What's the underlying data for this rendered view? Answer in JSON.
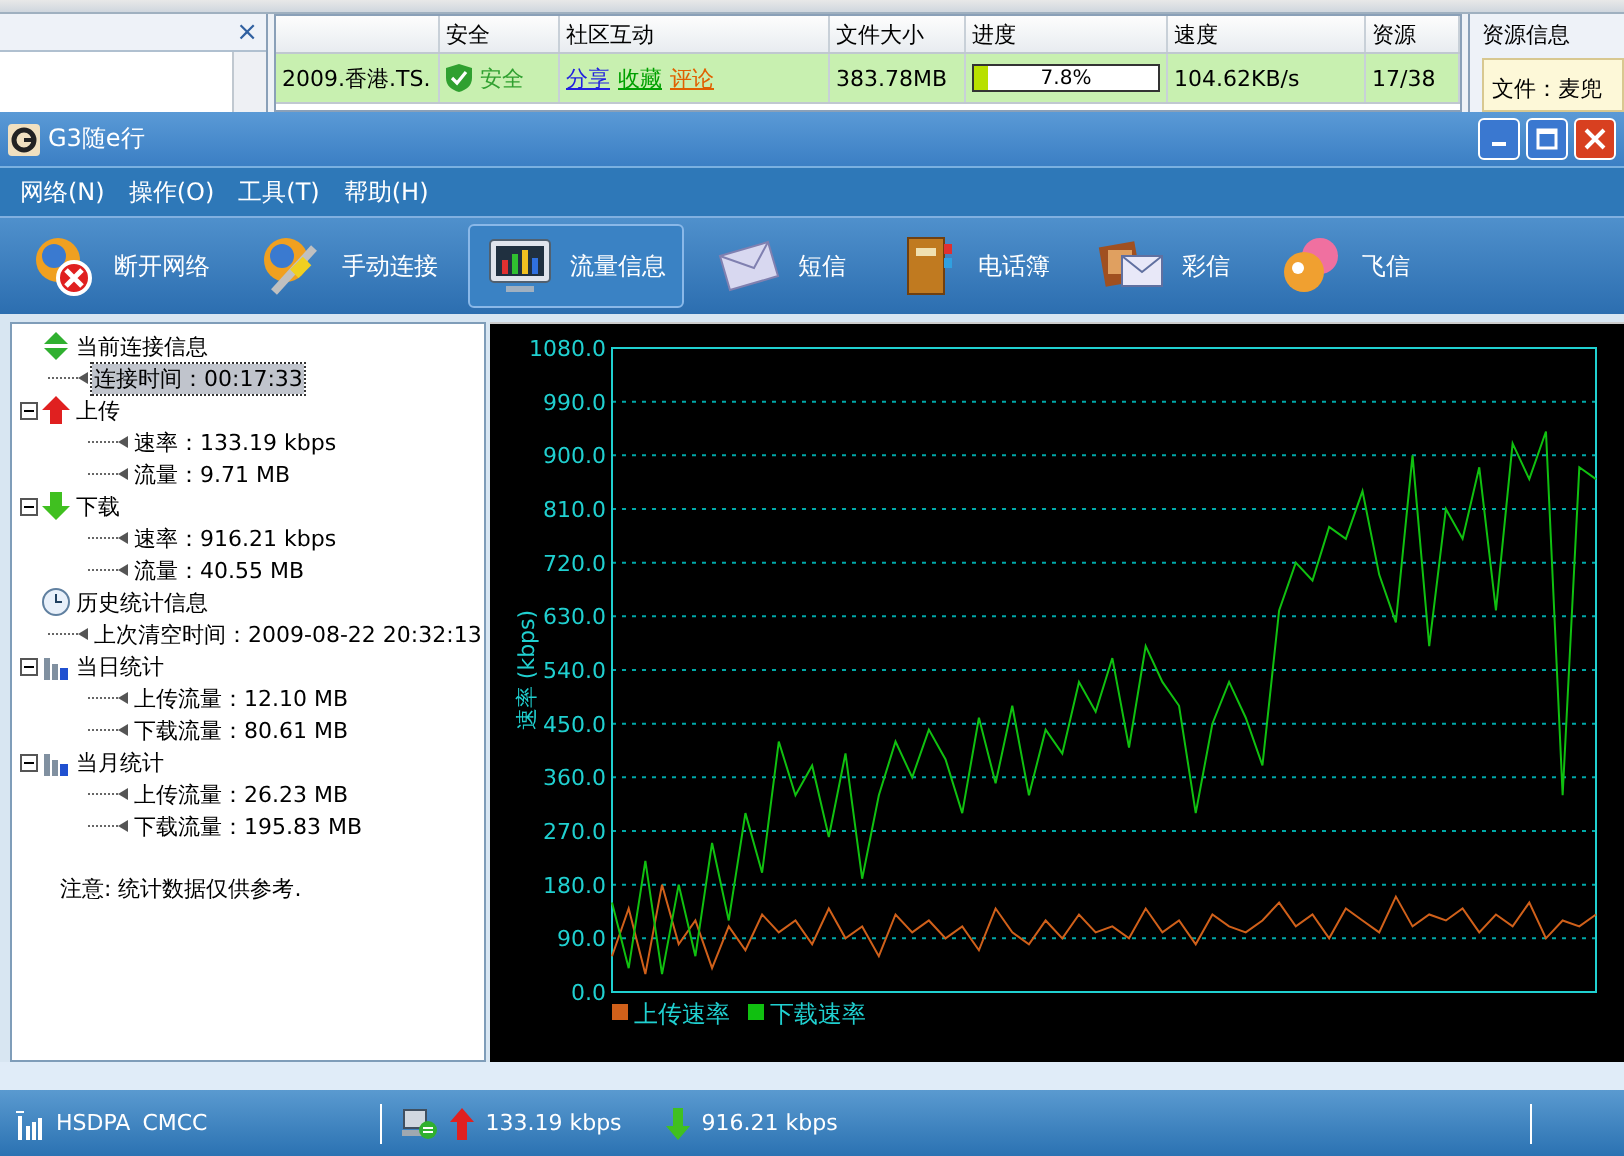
{
  "background_window": {
    "left_panel": {
      "close": "×"
    },
    "table": {
      "columns": [
        "",
        "安全",
        "社区互动",
        "文件大小",
        "进度",
        "速度",
        "资源"
      ],
      "rows": [
        {
          "name": "2009.香港.TS.",
          "safety": "安全",
          "links": [
            {
              "label": "分享",
              "color": "#2020e0"
            },
            {
              "label": "收藏",
              "color": "#00a000"
            },
            {
              "label": "评论",
              "color": "#e06000"
            }
          ],
          "size": "383.78MB",
          "progress": {
            "level": 0.078,
            "text": "7.8%"
          },
          "speed": "104.62KB/s",
          "sources": "17/38"
        }
      ]
    },
    "resource_panel": {
      "title": "资源信息",
      "file": "文件：麦兜"
    }
  },
  "window": {
    "title": "G3随e行"
  },
  "menu": [
    "网络(N)",
    "操作(O)",
    "工具(T)",
    "帮助(H)"
  ],
  "toolbar": [
    {
      "label": "断开网络",
      "selected": false
    },
    {
      "label": "手动连接",
      "selected": false
    },
    {
      "label": "流量信息",
      "selected": true
    },
    {
      "label": "短信",
      "selected": false
    },
    {
      "label": "电话簿",
      "selected": false
    },
    {
      "label": "彩信",
      "selected": false
    },
    {
      "label": "飞信",
      "selected": false
    }
  ],
  "tree": [
    {
      "label": "当前连接信息",
      "kind": "plain",
      "children": [
        {
          "label": "连接时间：00:17:33",
          "selected": true
        }
      ]
    },
    {
      "label": "上传",
      "kind": "toggle",
      "children": [
        {
          "label": "速率：133.19 kbps",
          "selected": false
        },
        {
          "label": "流量：9.71 MB",
          "selected": false
        }
      ]
    },
    {
      "label": "下载",
      "kind": "toggle",
      "children": [
        {
          "label": "速率：916.21 kbps",
          "selected": false
        },
        {
          "label": "流量：40.55 MB",
          "selected": false
        }
      ]
    },
    {
      "label": "历史统计信息",
      "kind": "plain",
      "children": [
        {
          "label": "上次清空时间：2009-08-22 20:32:13",
          "selected": false
        }
      ]
    },
    {
      "label": "当日统计",
      "kind": "toggle",
      "children": [
        {
          "label": "上传流量：12.10 MB",
          "selected": false
        },
        {
          "label": "下载流量：80.61 MB",
          "selected": false
        }
      ]
    },
    {
      "label": "当月统计",
      "kind": "toggle",
      "children": [
        {
          "label": "上传流量：26.23 MB",
          "selected": false
        },
        {
          "label": "下载流量：195.83 MB",
          "selected": false
        }
      ]
    }
  ],
  "note": "注意: 统计数据仅供参考.",
  "chart": {
    "chart_data": {
      "type": "line",
      "grid": true,
      "legend": "bottom",
      "ylabel": "速率 (kbps)",
      "ylim": [
        0,
        1080
      ],
      "yticks": [
        {
          "value": 0,
          "label": "0.0"
        },
        {
          "value": 90,
          "label": "90.0"
        },
        {
          "value": 180,
          "label": "180.0"
        },
        {
          "value": 270,
          "label": "270.0"
        },
        {
          "value": 360,
          "label": "360.0"
        },
        {
          "value": 450,
          "label": "450.0"
        },
        {
          "value": 540,
          "label": "540.0"
        },
        {
          "value": 630,
          "label": "630.0"
        },
        {
          "value": 720,
          "label": "720.0"
        },
        {
          "value": 810,
          "label": "810.0"
        },
        {
          "value": 900,
          "label": "900.0"
        },
        {
          "value": 990,
          "label": "990.0"
        },
        {
          "value": 1080,
          "label": "1080.0"
        }
      ],
      "series": [
        {
          "name": "上传速率",
          "color": "#d0601a",
          "values": [
            60,
            140,
            30,
            180,
            80,
            120,
            40,
            110,
            70,
            130,
            100,
            120,
            80,
            140,
            90,
            110,
            60,
            130,
            100,
            120,
            90,
            110,
            70,
            140,
            100,
            80,
            120,
            90,
            130,
            100,
            110,
            90,
            140,
            100,
            120,
            80,
            130,
            110,
            100,
            120,
            150,
            110,
            130,
            90,
            140,
            120,
            100,
            160,
            110,
            130,
            120,
            140,
            100,
            130,
            110,
            150,
            90,
            120,
            110,
            130
          ]
        },
        {
          "name": "下载速率",
          "color": "#10c010",
          "values": [
            150,
            40,
            220,
            30,
            180,
            60,
            250,
            120,
            300,
            200,
            420,
            330,
            380,
            260,
            400,
            190,
            330,
            420,
            360,
            440,
            390,
            300,
            460,
            350,
            480,
            330,
            440,
            400,
            520,
            470,
            560,
            410,
            580,
            520,
            480,
            300,
            450,
            520,
            460,
            380,
            640,
            720,
            690,
            780,
            760,
            840,
            700,
            620,
            900,
            580,
            810,
            760,
            880,
            640,
            920,
            860,
            940,
            330,
            880,
            860
          ]
        }
      ]
    }
  },
  "status_bar": {
    "network": "HSDPA",
    "carrier": "CMCC",
    "upload": "133.19 kbps",
    "download": "916.21 kbps"
  }
}
